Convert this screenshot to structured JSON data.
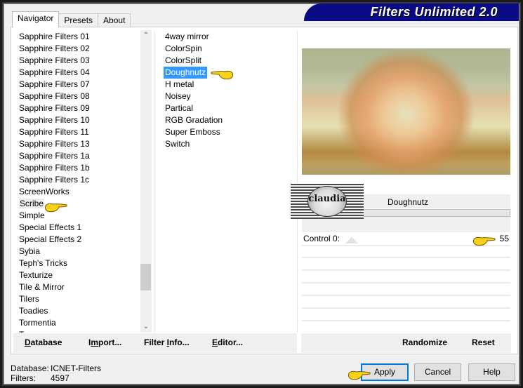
{
  "app": {
    "title": "Filters Unlimited 2.0"
  },
  "tabs": [
    {
      "label": "Navigator",
      "active": true
    },
    {
      "label": "Presets",
      "active": false
    },
    {
      "label": "About",
      "active": false
    }
  ],
  "categories": {
    "items": [
      "Sapphire Filters 01",
      "Sapphire Filters 02",
      "Sapphire Filters 03",
      "Sapphire Filters 04",
      "Sapphire Filters 07",
      "Sapphire Filters 08",
      "Sapphire Filters 09",
      "Sapphire Filters 10",
      "Sapphire Filters 11",
      "Sapphire Filters 13",
      "Sapphire Filters 1a",
      "Sapphire Filters 1b",
      "Sapphire Filters 1c",
      "ScreenWorks",
      "Scribe",
      "Simple",
      "Special Effects 1",
      "Special Effects 2",
      "Sybia",
      "Teph's Tricks",
      "Texturize",
      "Tile & Mirror",
      "Tilers",
      "Toadies",
      "Tormentia",
      "T..."
    ],
    "selected": "Scribe",
    "scroll_up_icon": "chevron-up-icon",
    "scroll_down_icon": "chevron-down-icon"
  },
  "filters": {
    "items": [
      "4way mirror",
      "ColorSpin",
      "ColorSplit",
      "Doughnutz",
      "H metal",
      "Noisey",
      "Partical",
      "RGB Gradation",
      "Super Emboss",
      "Switch"
    ],
    "selected": "Doughnutz"
  },
  "preview": {
    "filter_name": "Doughnutz",
    "watermark": "claudia"
  },
  "controls": [
    {
      "label": "Control 0:",
      "value": "55"
    }
  ],
  "left_buttons": {
    "database": {
      "pre": "",
      "u": "D",
      "post": "atabase"
    },
    "import": {
      "pre": "I",
      "u": "m",
      "post": "port..."
    },
    "filter_info": {
      "pre": "Filter ",
      "u": "I",
      "post": "nfo..."
    },
    "editor": {
      "pre": "",
      "u": "E",
      "post": "ditor..."
    }
  },
  "right_buttons": {
    "randomize": "Randomize",
    "reset": "Reset"
  },
  "status": {
    "database_label": "Database:",
    "database_value": "ICNET-Filters",
    "filters_label": "Filters:",
    "filters_value": "4597"
  },
  "dialog_buttons": {
    "apply": "Apply",
    "cancel": "Cancel",
    "help": "Help"
  },
  "colors": {
    "banner": "#0a0a84",
    "selection": "#3399ff",
    "default_button_border": "#0078d7"
  }
}
